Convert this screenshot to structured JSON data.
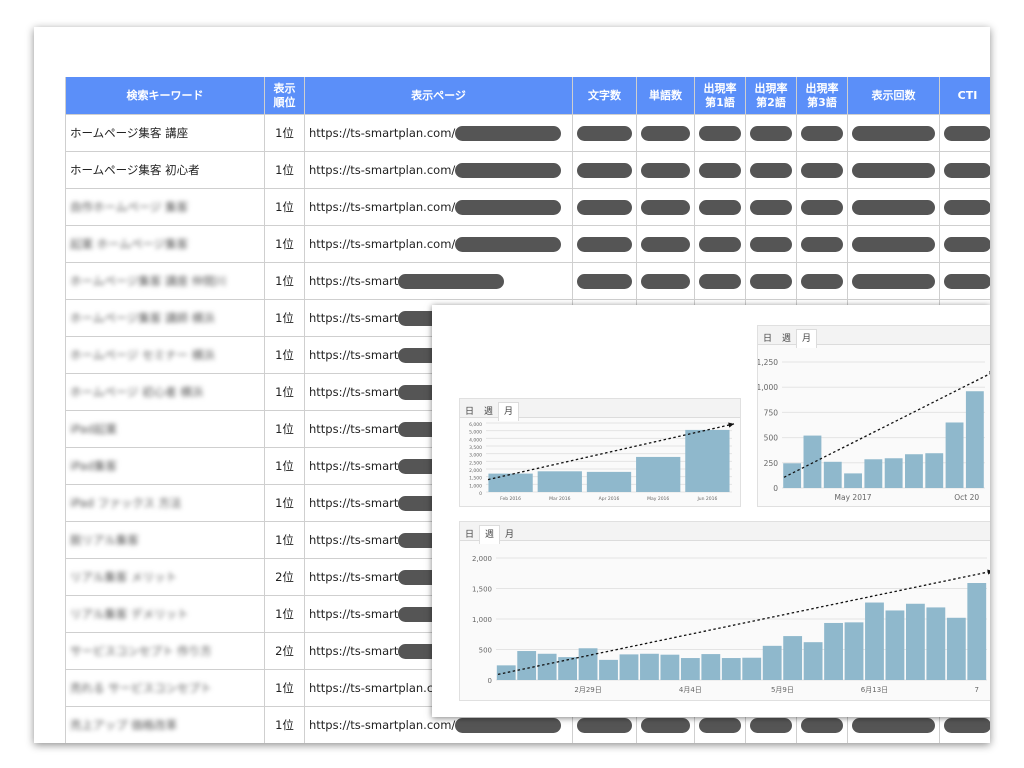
{
  "table": {
    "headers": {
      "keyword": "検索キーワード",
      "rank": "表示\n順位",
      "page": "表示ページ",
      "chars": "文字数",
      "words": "単語数",
      "freq1": "出現率\n第1語",
      "freq2": "出現率\n第2語",
      "freq3": "出現率\n第3語",
      "impressions": "表示回数",
      "ctr": "CTI"
    },
    "rows": [
      {
        "keyword": "ホームページ集客 講座",
        "blurred": false,
        "rank": "1位",
        "url": "https://ts-smartplan.com/"
      },
      {
        "keyword": "ホームページ集客 初心者",
        "blurred": false,
        "rank": "1位",
        "url": "https://ts-smartplan.com/"
      },
      {
        "keyword": "自作ホームページ 集客",
        "blurred": true,
        "rank": "1位",
        "url": "https://ts-smartplan.com/"
      },
      {
        "keyword": "起業 ホームページ集客",
        "blurred": true,
        "rank": "1位",
        "url": "https://ts-smartplan.com/"
      },
      {
        "keyword": "ホームページ集客 講座 仲間川",
        "blurred": true,
        "rank": "1位",
        "url": "https://ts-smart"
      },
      {
        "keyword": "ホームページ集客 講師 横浜",
        "blurred": true,
        "rank": "1位",
        "url": "https://ts-smart"
      },
      {
        "keyword": "ホームページ セミナー 横浜",
        "blurred": true,
        "rank": "1位",
        "url": "https://ts-smart"
      },
      {
        "keyword": "ホームページ 初心者 横浜",
        "blurred": true,
        "rank": "1位",
        "url": "https://ts-smart"
      },
      {
        "keyword": "iPad起業",
        "blurred": true,
        "rank": "1位",
        "url": "https://ts-smart"
      },
      {
        "keyword": "iPad集客",
        "blurred": true,
        "rank": "1位",
        "url": "https://ts-smart"
      },
      {
        "keyword": "iPad ファックス 方法",
        "blurred": true,
        "rank": "1位",
        "url": "https://ts-smart"
      },
      {
        "keyword": "脱リアル集客",
        "blurred": true,
        "rank": "1位",
        "url": "https://ts-smart"
      },
      {
        "keyword": "リアル集客 メリット",
        "blurred": true,
        "rank": "2位",
        "url": "https://ts-smart"
      },
      {
        "keyword": "リアル集客 デメリット",
        "blurred": true,
        "rank": "1位",
        "url": "https://ts-smart"
      },
      {
        "keyword": "サービスコンセプト 作り方",
        "blurred": true,
        "rank": "2位",
        "url": "https://ts-smart"
      },
      {
        "keyword": "売れる サービスコンセプト",
        "blurred": true,
        "rank": "1位",
        "url": "https://ts-smartplan.com/"
      },
      {
        "keyword": "売上アップ 価格改革",
        "blurred": true,
        "rank": "1位",
        "url": "https://ts-smartplan.com/"
      }
    ]
  },
  "charts": {
    "tabs": [
      "日",
      "週",
      "月"
    ],
    "monthly_small": {
      "active_tab": "月",
      "chart_data": {
        "type": "bar",
        "categories": [
          "Feb 2016",
          "Mar 2016",
          "Apr 2016",
          "May 2016",
          "Jun 2016"
        ],
        "values": [
          1600,
          1800,
          1750,
          3050,
          5400
        ],
        "ylim": [
          0,
          6000
        ],
        "yticks": [
          "0",
          "1,000",
          "1,500",
          "2,000",
          "2,500",
          "3,000",
          "3,500",
          "4,000",
          "5,000",
          "6,000"
        ]
      }
    },
    "monthly_large": {
      "active_tab": "月",
      "chart_data": {
        "type": "bar",
        "values": [
          245,
          520,
          260,
          145,
          285,
          295,
          335,
          345,
          650,
          960
        ],
        "xlabels": [
          "May 2017",
          "Oct 20"
        ],
        "ylim": [
          0,
          1250
        ],
        "yticks": [
          "0",
          "250",
          "500",
          "750",
          "1,000",
          "1,250"
        ]
      }
    },
    "weekly": {
      "active_tab": "週",
      "chart_data": {
        "type": "bar",
        "values": [
          240,
          475,
          430,
          375,
          520,
          330,
          420,
          430,
          415,
          360,
          425,
          360,
          365,
          560,
          720,
          620,
          935,
          945,
          1270,
          1140,
          1250,
          1190,
          1020,
          1590
        ],
        "xlabels": [
          "2月29日",
          "4月4日",
          "5月9日",
          "6月13日",
          "7"
        ],
        "ylim": [
          0,
          2000
        ],
        "yticks": [
          "0",
          "500",
          "1,000",
          "1,500",
          "2,000"
        ]
      }
    },
    "bar_color": "#8fb8cc",
    "trend_color": "#111111"
  }
}
